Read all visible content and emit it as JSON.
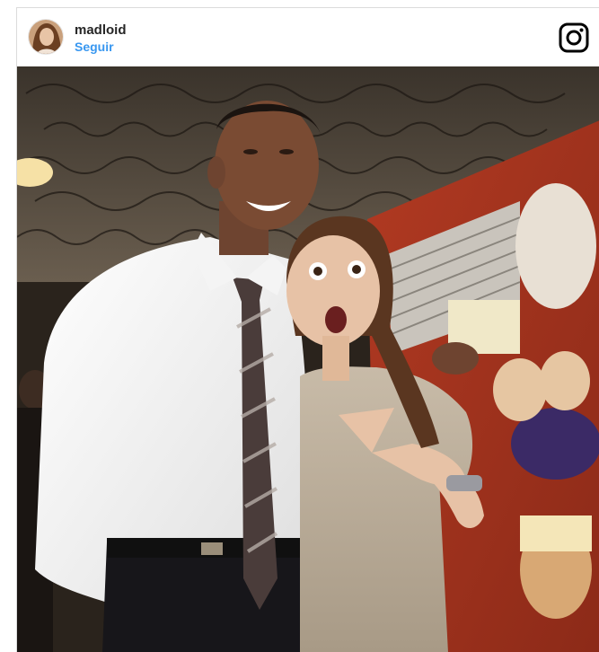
{
  "post": {
    "username": "madloid",
    "follow_label": "Seguir"
  },
  "icons": {
    "avatar": "profile-avatar",
    "brand": "instagram-glyph-icon"
  },
  "colors": {
    "follow_link": "#3897f0",
    "username": "#262626",
    "border": "#dbdbdb"
  }
}
